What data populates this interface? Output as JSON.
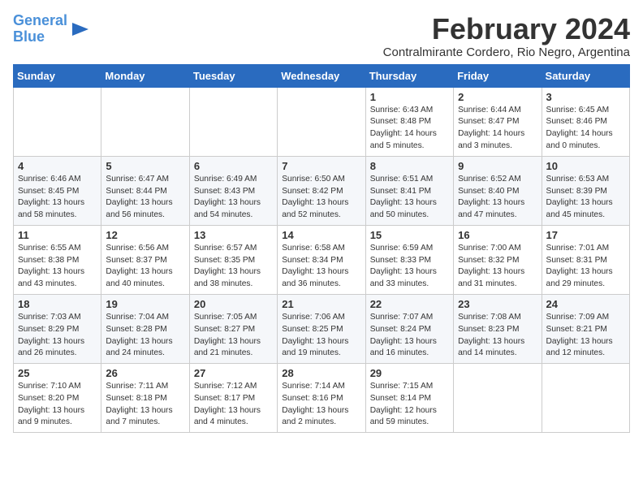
{
  "logo": {
    "line1": "General",
    "line2": "Blue",
    "arrow": "▶"
  },
  "title": "February 2024",
  "subtitle": "Contralmirante Cordero, Rio Negro, Argentina",
  "weekdays": [
    "Sunday",
    "Monday",
    "Tuesday",
    "Wednesday",
    "Thursday",
    "Friday",
    "Saturday"
  ],
  "weeks": [
    [
      {
        "day": "",
        "info": ""
      },
      {
        "day": "",
        "info": ""
      },
      {
        "day": "",
        "info": ""
      },
      {
        "day": "",
        "info": ""
      },
      {
        "day": "1",
        "info": "Sunrise: 6:43 AM\nSunset: 8:48 PM\nDaylight: 14 hours\nand 5 minutes."
      },
      {
        "day": "2",
        "info": "Sunrise: 6:44 AM\nSunset: 8:47 PM\nDaylight: 14 hours\nand 3 minutes."
      },
      {
        "day": "3",
        "info": "Sunrise: 6:45 AM\nSunset: 8:46 PM\nDaylight: 14 hours\nand 0 minutes."
      }
    ],
    [
      {
        "day": "4",
        "info": "Sunrise: 6:46 AM\nSunset: 8:45 PM\nDaylight: 13 hours\nand 58 minutes."
      },
      {
        "day": "5",
        "info": "Sunrise: 6:47 AM\nSunset: 8:44 PM\nDaylight: 13 hours\nand 56 minutes."
      },
      {
        "day": "6",
        "info": "Sunrise: 6:49 AM\nSunset: 8:43 PM\nDaylight: 13 hours\nand 54 minutes."
      },
      {
        "day": "7",
        "info": "Sunrise: 6:50 AM\nSunset: 8:42 PM\nDaylight: 13 hours\nand 52 minutes."
      },
      {
        "day": "8",
        "info": "Sunrise: 6:51 AM\nSunset: 8:41 PM\nDaylight: 13 hours\nand 50 minutes."
      },
      {
        "day": "9",
        "info": "Sunrise: 6:52 AM\nSunset: 8:40 PM\nDaylight: 13 hours\nand 47 minutes."
      },
      {
        "day": "10",
        "info": "Sunrise: 6:53 AM\nSunset: 8:39 PM\nDaylight: 13 hours\nand 45 minutes."
      }
    ],
    [
      {
        "day": "11",
        "info": "Sunrise: 6:55 AM\nSunset: 8:38 PM\nDaylight: 13 hours\nand 43 minutes."
      },
      {
        "day": "12",
        "info": "Sunrise: 6:56 AM\nSunset: 8:37 PM\nDaylight: 13 hours\nand 40 minutes."
      },
      {
        "day": "13",
        "info": "Sunrise: 6:57 AM\nSunset: 8:35 PM\nDaylight: 13 hours\nand 38 minutes."
      },
      {
        "day": "14",
        "info": "Sunrise: 6:58 AM\nSunset: 8:34 PM\nDaylight: 13 hours\nand 36 minutes."
      },
      {
        "day": "15",
        "info": "Sunrise: 6:59 AM\nSunset: 8:33 PM\nDaylight: 13 hours\nand 33 minutes."
      },
      {
        "day": "16",
        "info": "Sunrise: 7:00 AM\nSunset: 8:32 PM\nDaylight: 13 hours\nand 31 minutes."
      },
      {
        "day": "17",
        "info": "Sunrise: 7:01 AM\nSunset: 8:31 PM\nDaylight: 13 hours\nand 29 minutes."
      }
    ],
    [
      {
        "day": "18",
        "info": "Sunrise: 7:03 AM\nSunset: 8:29 PM\nDaylight: 13 hours\nand 26 minutes."
      },
      {
        "day": "19",
        "info": "Sunrise: 7:04 AM\nSunset: 8:28 PM\nDaylight: 13 hours\nand 24 minutes."
      },
      {
        "day": "20",
        "info": "Sunrise: 7:05 AM\nSunset: 8:27 PM\nDaylight: 13 hours\nand 21 minutes."
      },
      {
        "day": "21",
        "info": "Sunrise: 7:06 AM\nSunset: 8:25 PM\nDaylight: 13 hours\nand 19 minutes."
      },
      {
        "day": "22",
        "info": "Sunrise: 7:07 AM\nSunset: 8:24 PM\nDaylight: 13 hours\nand 16 minutes."
      },
      {
        "day": "23",
        "info": "Sunrise: 7:08 AM\nSunset: 8:23 PM\nDaylight: 13 hours\nand 14 minutes."
      },
      {
        "day": "24",
        "info": "Sunrise: 7:09 AM\nSunset: 8:21 PM\nDaylight: 13 hours\nand 12 minutes."
      }
    ],
    [
      {
        "day": "25",
        "info": "Sunrise: 7:10 AM\nSunset: 8:20 PM\nDaylight: 13 hours\nand 9 minutes."
      },
      {
        "day": "26",
        "info": "Sunrise: 7:11 AM\nSunset: 8:18 PM\nDaylight: 13 hours\nand 7 minutes."
      },
      {
        "day": "27",
        "info": "Sunrise: 7:12 AM\nSunset: 8:17 PM\nDaylight: 13 hours\nand 4 minutes."
      },
      {
        "day": "28",
        "info": "Sunrise: 7:14 AM\nSunset: 8:16 PM\nDaylight: 13 hours\nand 2 minutes."
      },
      {
        "day": "29",
        "info": "Sunrise: 7:15 AM\nSunset: 8:14 PM\nDaylight: 12 hours\nand 59 minutes."
      },
      {
        "day": "",
        "info": ""
      },
      {
        "day": "",
        "info": ""
      }
    ]
  ]
}
